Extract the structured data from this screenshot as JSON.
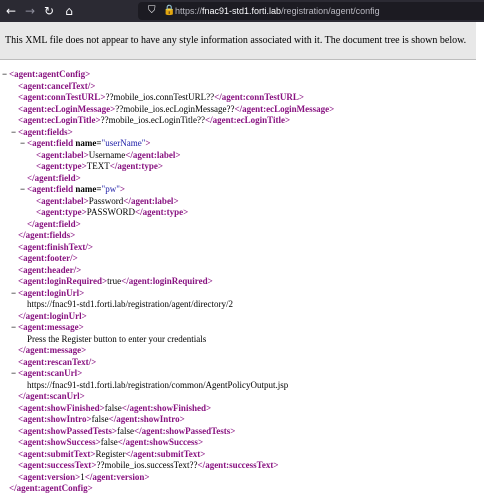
{
  "toolbar": {
    "back_icon": "back-arrow-icon",
    "forward_icon": "forward-arrow-icon",
    "reload_icon": "reload-icon",
    "home_icon": "home-icon",
    "url_prefix": "https://",
    "url_host": "fnac91-std1.forti.lab",
    "url_path": "/registration/agent/config"
  },
  "info_message": "This XML file does not appear to have any style information associated with it. The document tree is shown below.",
  "xml": {
    "root_tag": "agent:agentConfig",
    "cancel_text": "agent:cancelText",
    "conn_test_url_tag": "agent:connTestURL",
    "conn_test_url_value": "??mobile_ios.connTestURL??",
    "ec_login_message_tag": "agent:ecLoginMessage",
    "ec_login_message_value": "??mobile_ios.ecLoginMessage??",
    "ec_login_title_tag": "agent:ecLoginTitle",
    "ec_login_title_value": "??mobile_ios.ecLoginTitle??",
    "fields_tag": "agent:fields",
    "field_tag": "agent:field",
    "name_attr": "name",
    "field1_name": "userName",
    "label_tag": "agent:label",
    "type_tag": "agent:type",
    "field1_label": "Username",
    "field1_type": "TEXT",
    "field2_name": "pw",
    "field2_label": "Password",
    "field2_type": "PASSWORD",
    "finish_text": "agent:finishText",
    "footer": "agent:footer",
    "header": "agent:header",
    "login_required_tag": "agent:loginRequired",
    "login_required_value": "true",
    "login_url_tag": "agent:loginUrl",
    "login_url_value": "https://fnac91-std1.forti.lab/registration/agent/directory/2",
    "message_tag": "agent:message",
    "message_value": "Press the Register button to enter your credentials",
    "rescan_text": "agent:rescanText",
    "scan_url_tag": "agent:scanUrl",
    "scan_url_value": "https://fnac91-std1.forti.lab/registration/common/AgentPolicyOutput.jsp",
    "show_finished_tag": "agent:showFinished",
    "show_finished_value": "false",
    "show_intro_tag": "agent:showIntro",
    "show_intro_value": "false",
    "show_passed_tests_tag": "agent:showPassedTests",
    "show_passed_tests_value": "false",
    "show_success_tag": "agent:showSuccess",
    "show_success_value": "false",
    "submit_text_tag": "agent:submitText",
    "submit_text_value": "Register",
    "success_text_tag": "agent:successText",
    "success_text_value": "??mobile_ios.successText??",
    "version_tag": "agent:version",
    "version_value": "1"
  }
}
